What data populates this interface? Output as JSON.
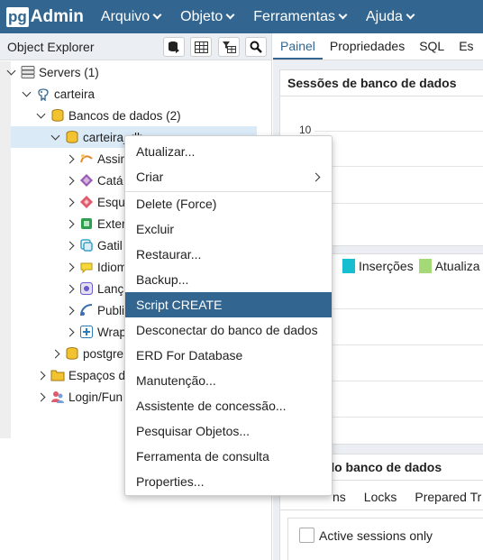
{
  "app": {
    "logo_box": "pg",
    "logo_text": "Admin"
  },
  "menu": [
    "Arquivo",
    "Objeto",
    "Ferramentas",
    "Ajuda"
  ],
  "explorer": {
    "title": "Object Explorer"
  },
  "tree": {
    "servers": "Servers (1)",
    "carteira": "carteira",
    "bancos": "Bancos de dados (2)",
    "carteira_db": "carteira_db",
    "children": [
      "Assin",
      "Catá",
      "Esqu",
      "Exter",
      "Gatil",
      "Idiom",
      "Lanç",
      "Publi",
      "Wrap"
    ],
    "postgres": "postgre",
    "espacos": "Espaços d",
    "login": "Login/Fun"
  },
  "right": {
    "tabs": [
      "Painel",
      "Propriedades",
      "SQL",
      "Es"
    ],
    "sessions_title": "Sessões de banco de dados",
    "y_tick": "10",
    "legend": [
      {
        "label": "Inserções",
        "color": "#17becf"
      },
      {
        "label": "Atualiza",
        "color": "#a3d977"
      }
    ],
    "activity_title": "le do banco de dados",
    "activity_tabs": [
      "ns",
      "Locks",
      "Prepared Tr"
    ],
    "active_only": "Active sessions only"
  },
  "context_menu": {
    "items": [
      "Atualizar...",
      "Criar",
      "Delete (Force)",
      "Excluir",
      "Restaurar...",
      "Backup...",
      "Script CREATE",
      "Desconectar do banco de dados",
      "ERD For Database",
      "Manutenção...",
      "Assistente de concessão...",
      "Pesquisar Objetos...",
      "Ferramenta de consulta",
      "Properties..."
    ],
    "highlighted": "Script CREATE"
  }
}
